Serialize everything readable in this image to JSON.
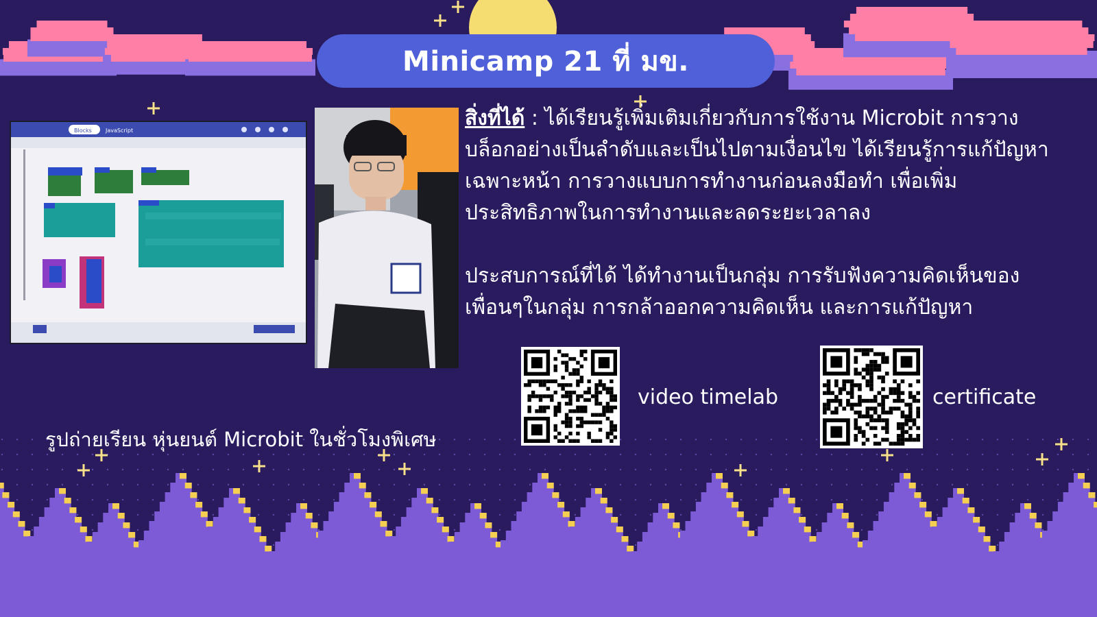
{
  "title": "Minicamp 21 ที่ มข.",
  "content": {
    "lead_label": "สิ่งที่ได้",
    "lead_sep": " : ",
    "learned_text": "ได้เรียนรู้เพิ่มเติมเกี่ยวกับการใช้งาน Microbit การวางบล็อกอย่างเป็นลำดับและเป็นไปตามเงื่อนไข ได้เรียนรู้การแก้ปัญหาเฉพาะหน้า การวางแบบการทำงานก่อนลงมือทำ เพื่อเพิ่มประสิทธิภาพในการทำงานและลดระยะเวลาลง",
    "experience_text": "ประสบการณ์ที่ได้ ได้ทำงานเป็นกลุ่ม การรับฟังความคิดเห็นของเพื่อนๆในกลุ่ม การกล้าออกความคิดเห็น และการแก้ปัญหา"
  },
  "photo_caption": "รูปถ่ายเรียน หุ่นยนต์ Microbit ในชั่วโมงพิเศษ",
  "screen": {
    "tab_blocks": "Blocks",
    "tab_js": "JavaScript"
  },
  "qr_codes": [
    {
      "label": "video timelab"
    },
    {
      "label": "certificate"
    }
  ],
  "colors": {
    "background": "#2a1a5e",
    "title_pill": "#5060d8",
    "tree": "#7d5ad6",
    "tree_highlight": "#f4cf52",
    "cloud": "#ff7fa6",
    "cloud_base": "#8a6fe0",
    "moon": "#f6dd72"
  }
}
